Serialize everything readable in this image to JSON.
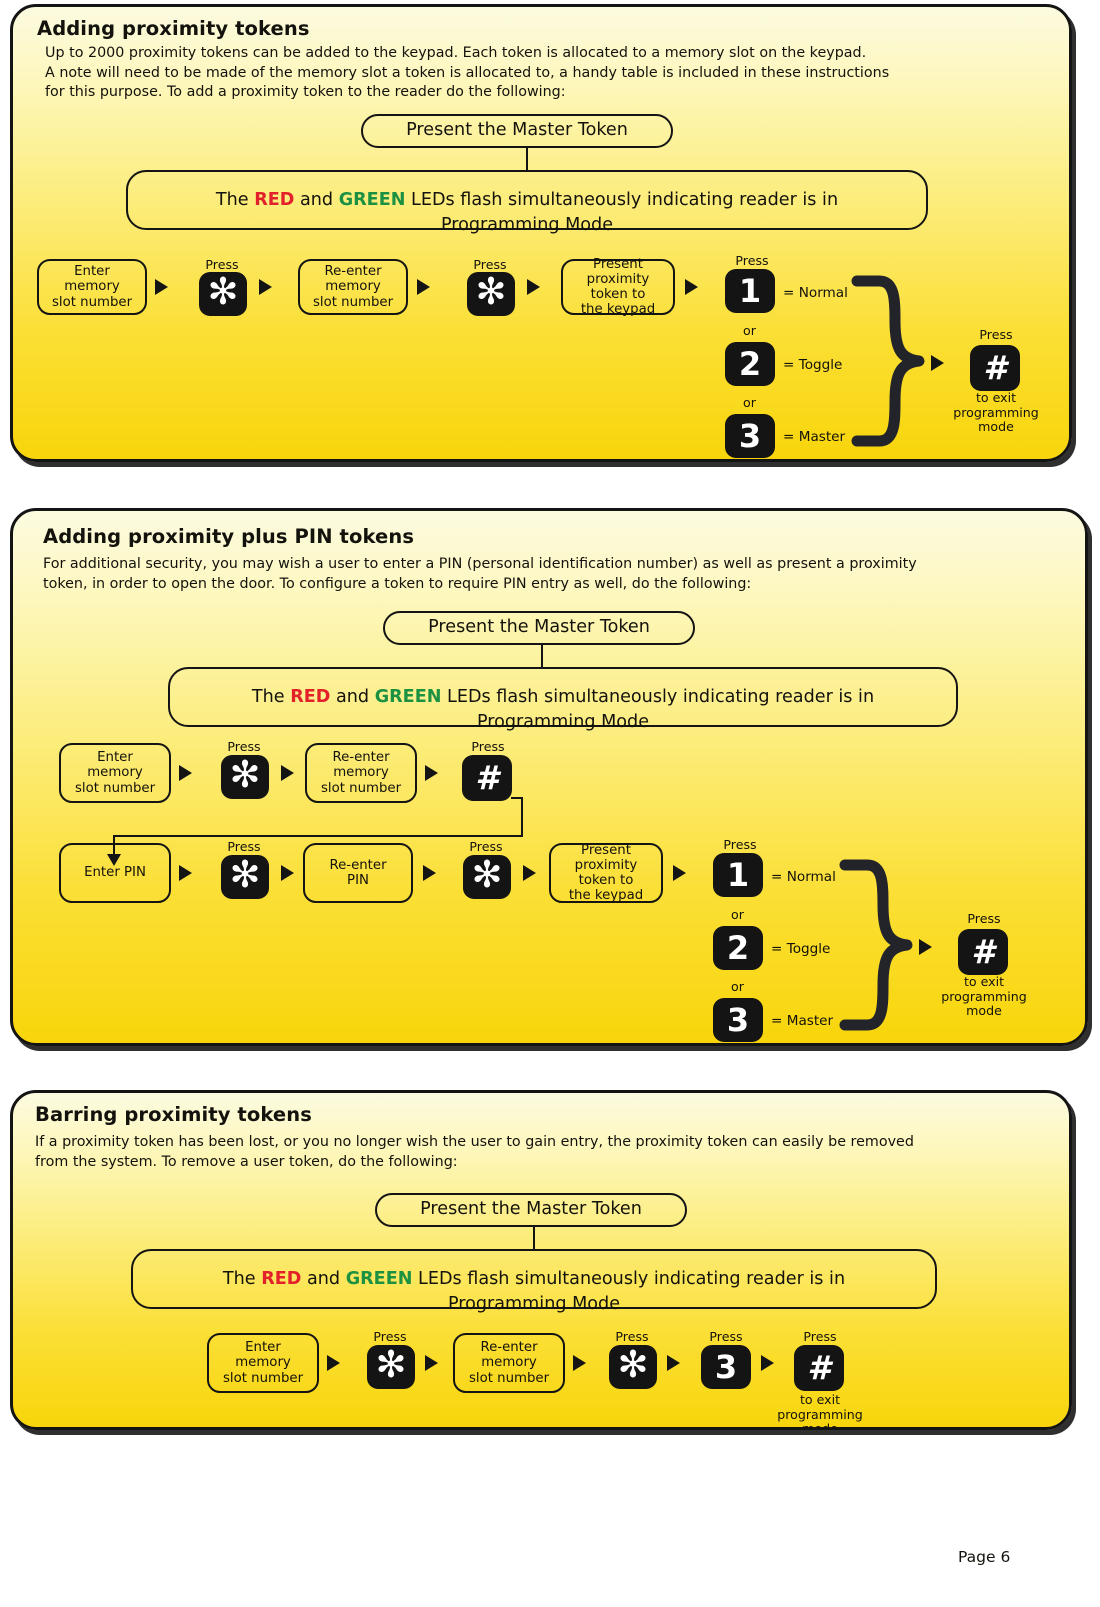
{
  "document": {
    "page_label": "Page 6"
  },
  "colors": {
    "red": "#e3212a",
    "green": "#1c9142",
    "panel_border": "#141414",
    "key_background": "#141414",
    "panel_top": "#fcfbe0",
    "panel_bottom": "#f8d50b"
  },
  "common": {
    "press_label": "Press",
    "or_label": "or",
    "exit_label": "to exit\nprogramming\nmode",
    "master_token_box": "Present the Master Token",
    "led_prefix": "The ",
    "led_red": "RED",
    "led_mid": " and ",
    "led_green": "GREEN",
    "led_suffix": " LEDs flash simultaneously indicating reader is in",
    "led_line2": "Programming Mode",
    "enter_memory_slot": "Enter\nmemory\nslot number",
    "reenter_memory_slot": "Re-enter\nmemory\nslot number",
    "present_token": "Present proximity\ntoken to\nthe keypad",
    "key_star": "✻",
    "key_hash": "#",
    "key_1": "1",
    "key_2": "2",
    "key_3": "3",
    "eq_normal": "= Normal",
    "eq_toggle": "= Toggle",
    "eq_master": "= Master"
  },
  "sections": [
    {
      "id": "adding-proximity-tokens",
      "title": "Adding proximity tokens",
      "body": "Up to 2000 proximity tokens can be added to the keypad.  Each token is allocated to a memory slot on the keypad.\nA note will need to be made of the memory slot a token is allocated to, a handy table is included in these instructions\nfor this purpose.  To add a proximity token to the reader do the following:"
    },
    {
      "id": "adding-proximity-plus-pin-tokens",
      "title": "Adding proximity plus PIN tokens",
      "body": "For additional security, you may wish a user to enter a PIN (personal identification number) as well as present a proximity\ntoken, in order to open the door.  To configure a token to require PIN entry as well, do the following:",
      "enter_pin": "Enter PIN",
      "reenter_pin": "Re-enter\nPIN"
    },
    {
      "id": "barring-proximity-tokens",
      "title": "Barring proximity tokens",
      "body": "If a proximity token has been lost, or you no longer wish the user to gain entry, the proximity token can easily be removed\nfrom the system.  To remove a user token, do the following:"
    }
  ]
}
